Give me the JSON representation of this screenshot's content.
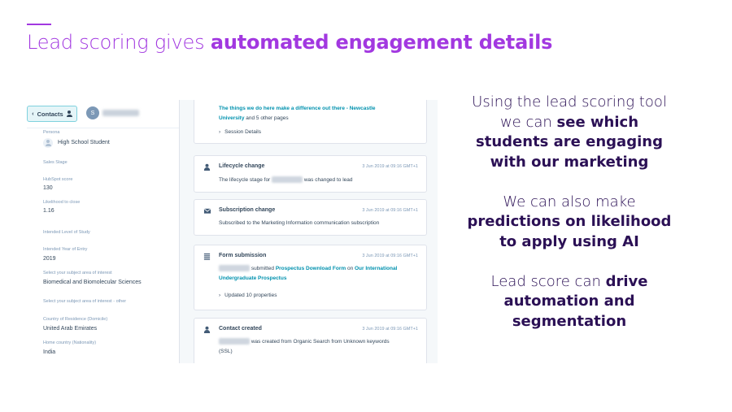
{
  "title": {
    "normal": "Lead scoring gives ",
    "bold": "automated engagement details"
  },
  "crm": {
    "contacts_button": "Contacts",
    "avatar_initial": "S",
    "properties": {
      "persona_label": "Persona",
      "persona_value": "High School Student",
      "sales_stage_label": "Sales Stage",
      "hubspot_score_label": "HubSpot score",
      "hubspot_score_value": "130",
      "likelihood_label": "Likelihood to close",
      "likelihood_value": "1.16",
      "level_label": "Intended Level of Study",
      "year_label": "Intended Year of Entry",
      "year_value": "2019",
      "subject_label": "Select your subject area of interest",
      "subject_value": "Biomedical and Biomolecular Sciences",
      "subject_other_label": "Select your subject area of interest - other",
      "residence_label": "Country of Residence (Domicile)",
      "residence_value": "United Arab Emirates",
      "home_label": "Home country (Nationality)",
      "home_value": "India"
    },
    "timeline": {
      "top_card": {
        "link_line1": "The things we do here make a difference out there - Newcastle",
        "link_line2": "University",
        "rest_line2": " and 5 other pages",
        "details": "Session Details"
      },
      "lifecycle": {
        "title": "Lifecycle change",
        "date": "3 Jun 2019 at 09:16 GMT+1",
        "pre": "The lifecycle stage for",
        "post": "was changed to lead"
      },
      "subscription": {
        "title": "Subscription change",
        "date": "3 Jun 2019 at 09:16 GMT+1",
        "body": "Subscribed to the Marketing Information communication subscription"
      },
      "form": {
        "title": "Form submission",
        "date": "3 Jun 2019 at 09:16 GMT+1",
        "submitted": "submitted",
        "form_name": "Prospectus Download Form",
        "on": "on",
        "page_line1": "Our International",
        "page_line2": "Undergraduate Prospectus",
        "updated": "Updated 10 properties"
      },
      "created": {
        "title": "Contact created",
        "date": "3 Jun 2019 at 09:16 GMT+1",
        "body_line1": "was created from Organic Search from Unknown keywords",
        "body_line2": "(SSL)"
      }
    }
  },
  "side_text": {
    "p1_line1": "Using the lead scoring tool",
    "p1_line2_normal": "we can ",
    "p1_line2_bold": "see which",
    "p1_line3": "students are engaging",
    "p1_line4": "with our marketing",
    "p2_line1": "We can also make",
    "p2_line2": "predictions on likelihood",
    "p2_line3": "to apply using AI",
    "p3_line1_normal": "Lead score can ",
    "p3_line1_bold": "drive",
    "p3_line2": "automation and",
    "p3_line3": "segmentation"
  },
  "colors": {
    "accent": "#a238e0",
    "navy": "#2b1055",
    "link": "#0091ae"
  }
}
